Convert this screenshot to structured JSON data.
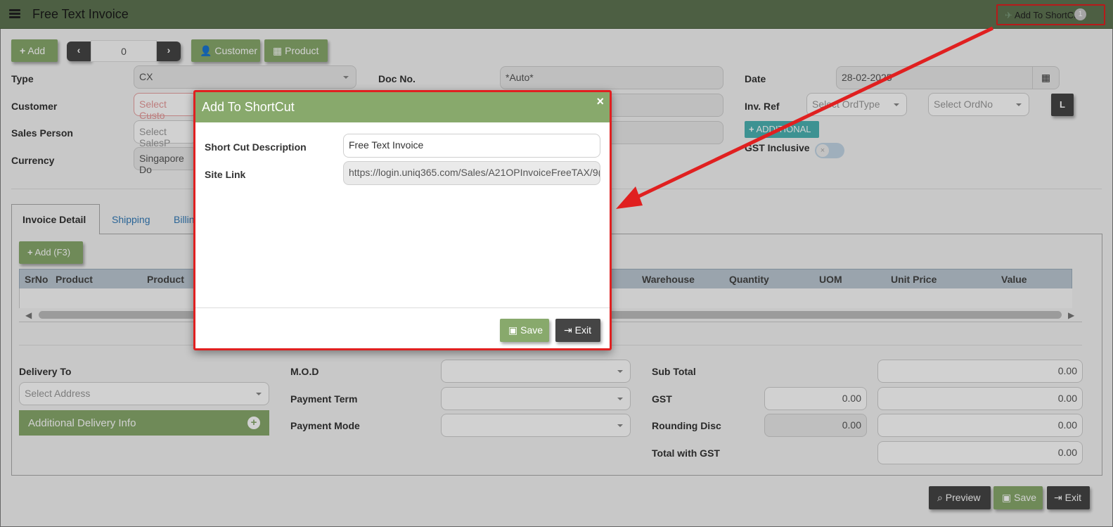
{
  "header": {
    "title": "Free Text Invoice",
    "shortcut_label": "Add To ShortCut",
    "shortcut_count": "1"
  },
  "toolbar": {
    "add": "Add",
    "record_no": "0",
    "customer": "Customer",
    "product": "Product"
  },
  "form": {
    "type_label": "Type",
    "type_value": "CX",
    "customer_label": "Customer",
    "customer_placeholder": "Select Custo",
    "sales_person_label": "Sales Person",
    "sales_person_placeholder": "Select SalesP",
    "currency_label": "Currency",
    "currency_value": "Singapore Do",
    "doc_no_label": "Doc No.",
    "doc_no_value": "*Auto*",
    "date_label": "Date",
    "date_value": "28-02-2025",
    "inv_ref_label": "Inv. Ref",
    "ord_type_placeholder": "Select OrdType",
    "ord_no_placeholder": "Select OrdNo",
    "l_button": "L",
    "additional_label": "ADDITIONAL",
    "gst_inclusive_label": "GST Inclusive"
  },
  "tabs": [
    "Invoice Detail",
    "Shipping",
    "Billin"
  ],
  "grid": {
    "add_label": "Add (F3)",
    "columns": [
      "SrNo",
      "Product",
      "Product",
      "Warehouse",
      "Quantity",
      "UOM",
      "Unit Price",
      "Value"
    ]
  },
  "footer": {
    "delivery_to_label": "Delivery To",
    "address_placeholder": "Select Address",
    "additional_delivery_label": "Additional Delivery Info",
    "mod_label": "M.O.D",
    "payment_term_label": "Payment Term",
    "payment_mode_label": "Payment Mode",
    "sub_total_label": "Sub Total",
    "sub_total_value": "0.00",
    "gst_label": "GST",
    "gst_rate_value": "0.00",
    "gst_value": "0.00",
    "rounding_label": "Rounding Disc",
    "rounding_rate_value": "0.00",
    "rounding_value": "0.00",
    "total_label": "Total with GST",
    "total_value": "0.00",
    "preview": "Preview",
    "save": "Save",
    "exit": "Exit"
  },
  "modal": {
    "title": "Add To ShortCut",
    "close": "×",
    "desc_label": "Short Cut Description",
    "desc_value": "Free Text Invoice",
    "link_label": "Site Link",
    "link_value": "https://login.uniq365.com/Sales/A21OPInvoiceFreeTAX/9(",
    "save": "Save",
    "exit": "Exit"
  },
  "colors": {
    "header": "#5f7552",
    "accent_green": "#88a96c",
    "dark_button": "#454545",
    "highlight_red": "#e02020",
    "teal": "#4bb3b3"
  }
}
